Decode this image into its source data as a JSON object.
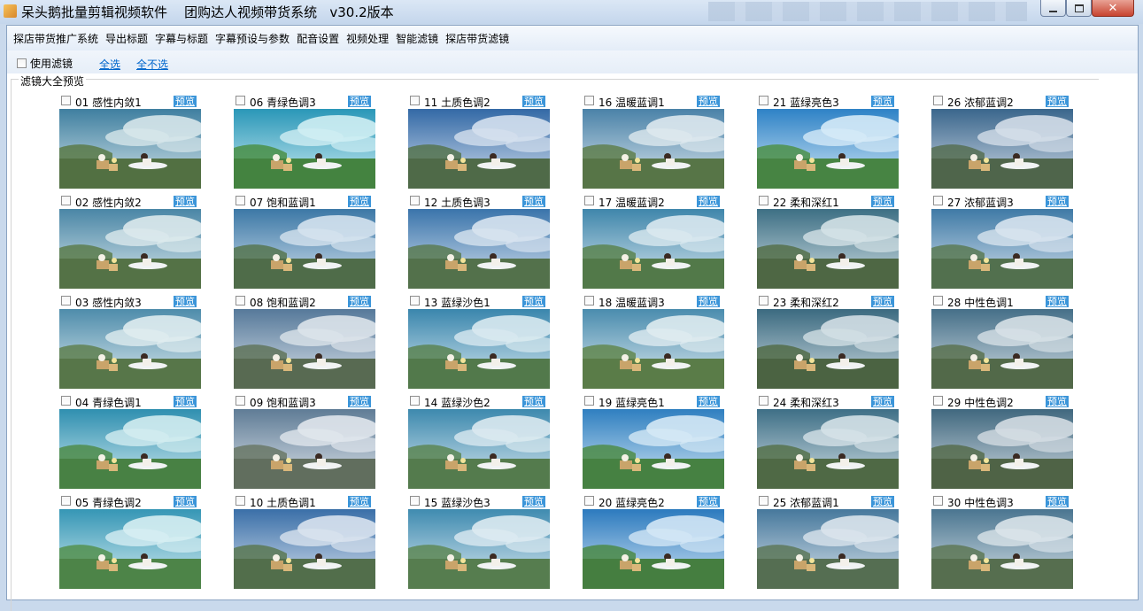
{
  "window": {
    "title": "呆头鹅批量剪辑视频软件    团购达人视频带货系统   v30.2版本",
    "controls": [
      "minimize",
      "maximize",
      "close"
    ]
  },
  "menu": {
    "items": [
      {
        "label": "探店带货推广系统"
      },
      {
        "label": "导出标题"
      },
      {
        "label": "字幕与标题"
      },
      {
        "label": "字幕预设与参数"
      },
      {
        "label": "配音设置"
      },
      {
        "label": "视频处理"
      },
      {
        "label": "智能滤镜"
      },
      {
        "label": "探店带货滤镜"
      }
    ]
  },
  "options": {
    "use_filter_label": "使用滤镜",
    "use_filter_checked": false,
    "select_all": "全选",
    "select_none": "全不选"
  },
  "gallery": {
    "title": "滤镜大全预览",
    "preview_label": "预览",
    "filters": [
      {
        "label": "01 感性内敛1",
        "sky": "#3f7fa0",
        "grass": "#5a7a48",
        "tint": "#d6e6ea"
      },
      {
        "label": "02 感性内敛2",
        "sky": "#4a86a6",
        "grass": "#5c7c4c",
        "tint": "#dbe9ec"
      },
      {
        "label": "03 感性内敛3",
        "sky": "#4e8cab",
        "grass": "#5f8050",
        "tint": "#dfecef"
      },
      {
        "label": "04 青绿色调1",
        "sky": "#2f8fb0",
        "grass": "#4f8c4a",
        "tint": "#d2ecf0"
      },
      {
        "label": "05 青绿色调2",
        "sky": "#3596b5",
        "grass": "#54904f",
        "tint": "#d6eef2"
      },
      {
        "label": "06 青绿色调3",
        "sky": "#2a97b8",
        "grass": "#4a8f46",
        "tint": "#cfeef3"
      },
      {
        "label": "07 饱和蓝调1",
        "sky": "#3c78a6",
        "grass": "#567650",
        "tint": "#d4e2ee"
      },
      {
        "label": "08 饱和蓝调2",
        "sky": "#56799a",
        "grass": "#60745a",
        "tint": "#dbe3ea"
      },
      {
        "label": "09 饱和蓝调3",
        "sky": "#5f7c96",
        "grass": "#6a7866",
        "tint": "#e0e6ec"
      },
      {
        "label": "10 土质色调1",
        "sky": "#3a6fa8",
        "grass": "#5a7852",
        "tint": "#d8e2ee"
      },
      {
        "label": "11 土质色调2",
        "sky": "#3369a6",
        "grass": "#56744f",
        "tint": "#d4e0ee"
      },
      {
        "label": "12 土质色调3",
        "sky": "#3a74ab",
        "grass": "#5b7b52",
        "tint": "#d7e3ef"
      },
      {
        "label": "13 蓝绿沙色1",
        "sky": "#3a86ad",
        "grass": "#5a8452",
        "tint": "#d8e9f0"
      },
      {
        "label": "14 蓝绿沙色2",
        "sky": "#3d89ae",
        "grass": "#5c8654",
        "tint": "#dae9f0"
      },
      {
        "label": "15 蓝绿沙色3",
        "sky": "#3f8bb0",
        "grass": "#5e8856",
        "tint": "#dceaf1"
      },
      {
        "label": "16 温暖蓝调1",
        "sky": "#4a82a8",
        "grass": "#5f7f4e",
        "tint": "#dde8ee"
      },
      {
        "label": "17 温暖蓝调2",
        "sky": "#3f86ab",
        "grass": "#5a8450",
        "tint": "#d9e8ef"
      },
      {
        "label": "18 温暖蓝调3",
        "sky": "#4a8cae",
        "grass": "#62874f",
        "tint": "#deebf0"
      },
      {
        "label": "19 蓝绿亮色1",
        "sky": "#2f7fc0",
        "grass": "#4d8c48",
        "tint": "#d4e8f5"
      },
      {
        "label": "20 蓝绿亮色2",
        "sky": "#2c7abe",
        "grass": "#4b8946",
        "tint": "#d2e6f5"
      },
      {
        "label": "21 蓝绿亮色3",
        "sky": "#2e82c6",
        "grass": "#4e9049",
        "tint": "#d5eaf7"
      },
      {
        "label": "22 柔和深红1",
        "sky": "#3d6f84",
        "grass": "#55704a",
        "tint": "#d3e1e6"
      },
      {
        "label": "23 柔和深红2",
        "sky": "#3b6a80",
        "grass": "#526c48",
        "tint": "#d1dee4"
      },
      {
        "label": "24 柔和深红3",
        "sky": "#3e6f86",
        "grass": "#56724b",
        "tint": "#d4e1e7"
      },
      {
        "label": "25 浓郁蓝调1",
        "sky": "#46789c",
        "grass": "#5d7859",
        "tint": "#dae4ec"
      },
      {
        "label": "26 浓郁蓝调2",
        "sky": "#3a668c",
        "grass": "#566e52",
        "tint": "#d3dde8"
      },
      {
        "label": "27 浓郁蓝调3",
        "sky": "#3f7aa6",
        "grass": "#5a7a55",
        "tint": "#d7e3ee"
      },
      {
        "label": "28 中性色调1",
        "sky": "#456f88",
        "grass": "#5a7250",
        "tint": "#d6e0e6"
      },
      {
        "label": "29 中性色调2",
        "sky": "#40687f",
        "grass": "#566c4c",
        "tint": "#d3dce2"
      },
      {
        "label": "30 中性色调3",
        "sky": "#4a7590",
        "grass": "#5e7856",
        "tint": "#d9e3e9"
      }
    ]
  }
}
